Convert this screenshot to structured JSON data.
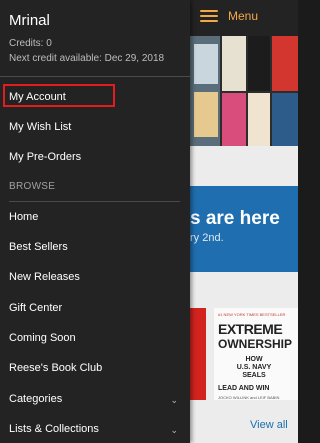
{
  "header": {
    "menu_label": "Menu"
  },
  "drawer": {
    "user_name": "Mrinal",
    "credits": "Credits: 0",
    "next_credit": "Next credit available: Dec 29, 2018",
    "account_items": [
      {
        "label": "My Account"
      },
      {
        "label": "My Wish List"
      },
      {
        "label": "My Pre-Orders"
      }
    ],
    "browse_header": "BROWSE",
    "browse_items": [
      {
        "label": "Home"
      },
      {
        "label": "Best Sellers"
      },
      {
        "label": "New Releases"
      },
      {
        "label": "Gift Center"
      },
      {
        "label": "Coming Soon"
      },
      {
        "label": "Reese's Book Club"
      },
      {
        "label": "Categories"
      },
      {
        "label": "Lists & Collections"
      }
    ]
  },
  "background": {
    "promo_text": "s are here",
    "promo_sub": "ry 2nd.",
    "book_top_text": "#1 NEW YORK TIMES BESTSELLER",
    "book_title_1": "EXTREME",
    "book_title_2": "OWNERSHIP",
    "book_how": "HOW",
    "book_seals": "U.S. NAVY SEALS",
    "book_lead": "LEAD AND WIN",
    "book_authors": "JOCKO WILLINK and LEIF BABIN",
    "view_all": "View all"
  },
  "colors": {
    "drawer_bg": "#232323",
    "accent": "#f3a847",
    "highlight": "#e31d1d",
    "link": "#1a6fb0"
  },
  "icons": {
    "menu": "hamburger-menu-icon",
    "expand": "chevron-down-icon"
  }
}
